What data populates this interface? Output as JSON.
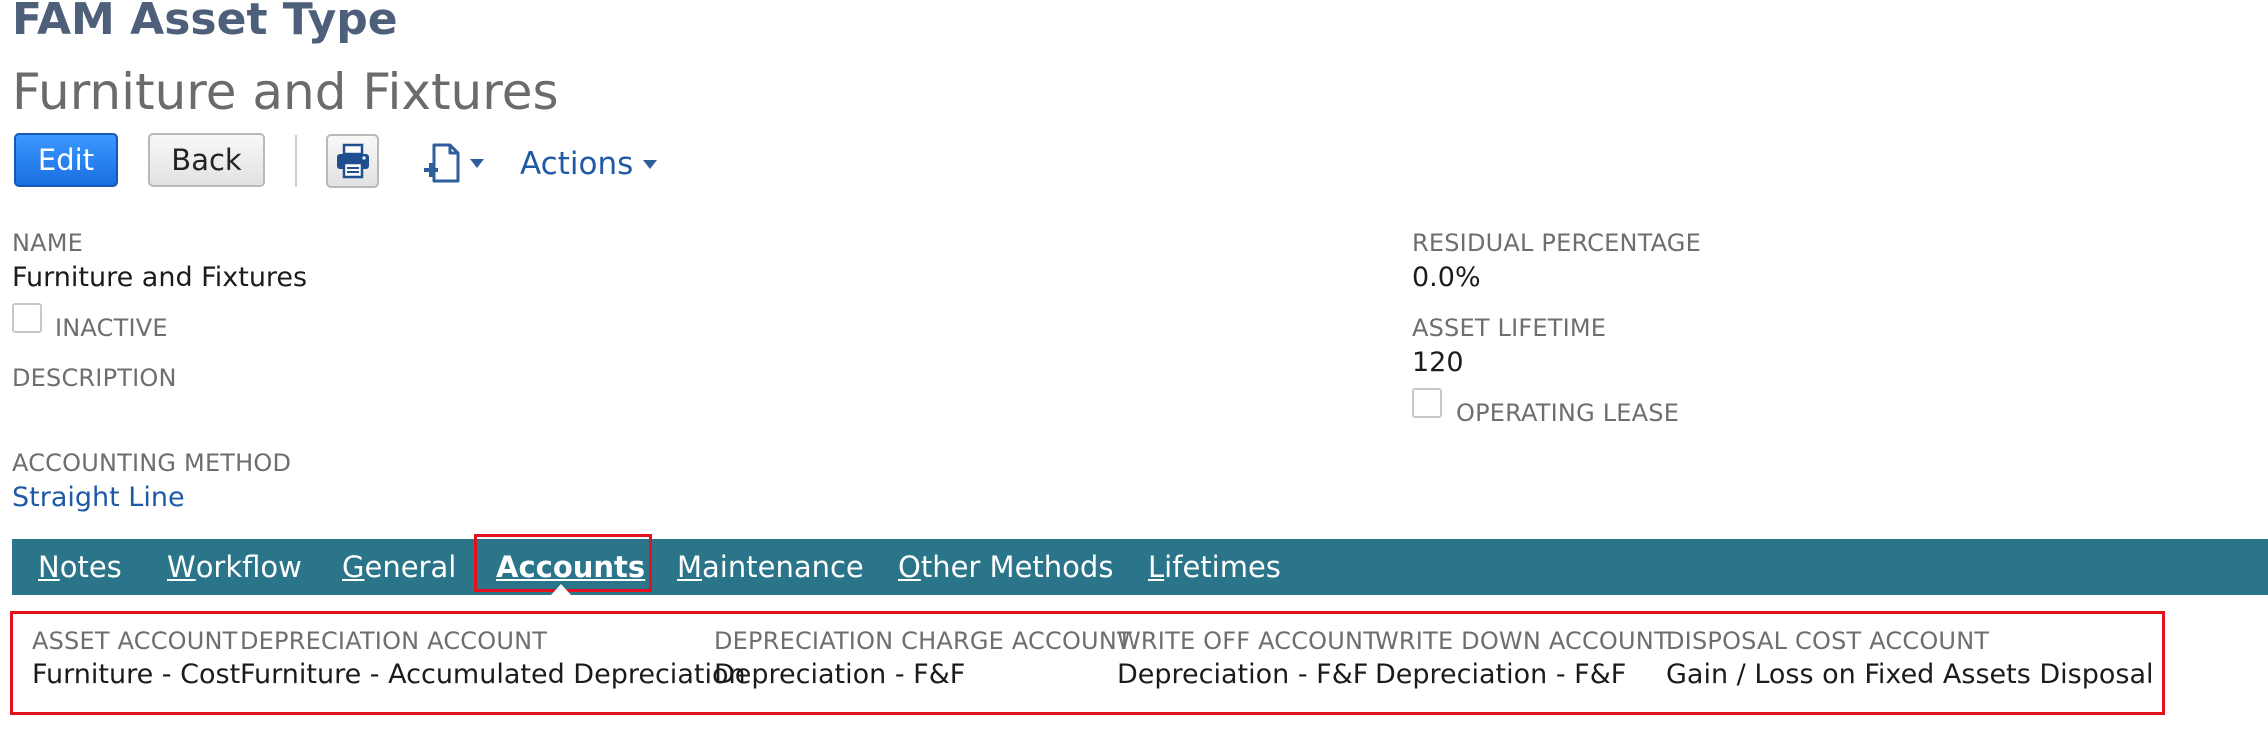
{
  "header": {
    "record_type": "FAM Asset Type",
    "record_name": "Furniture and Fixtures"
  },
  "toolbar": {
    "edit_label": "Edit",
    "back_label": "Back",
    "actions_label": "Actions"
  },
  "fields": {
    "name_label": "NAME",
    "name_value": "Furniture and Fixtures",
    "inactive_label": "INACTIVE",
    "inactive_checked": false,
    "description_label": "DESCRIPTION",
    "accounting_method_label": "ACCOUNTING METHOD",
    "accounting_method_value": "Straight Line",
    "residual_percentage_label": "RESIDUAL PERCENTAGE",
    "residual_percentage_value": "0.0%",
    "asset_lifetime_label": "ASSET LIFETIME",
    "asset_lifetime_value": "120",
    "operating_lease_label": "OPERATING LEASE",
    "operating_lease_checked": false
  },
  "tabs": [
    {
      "key": "N",
      "rest": "otes",
      "active": false
    },
    {
      "key": "W",
      "rest": "orkflow",
      "active": false
    },
    {
      "key": "G",
      "rest": "eneral",
      "active": false
    },
    {
      "key": "A",
      "rest": "ccounts",
      "active": true
    },
    {
      "key": "M",
      "rest": "aintenance",
      "active": false
    },
    {
      "key": "O",
      "rest": "ther Methods",
      "active": false
    },
    {
      "key": "L",
      "rest": "ifetimes",
      "active": false
    }
  ],
  "accounts": {
    "asset_account_label": "ASSET ACCOUNT",
    "asset_account_value": "Furniture - Cost",
    "depreciation_account_label": "DEPRECIATION ACCOUNT",
    "depreciation_account_value": "Furniture - Accumulated Depreciation",
    "depreciation_charge_account_label": "DEPRECIATION CHARGE ACCOUNT",
    "depreciation_charge_account_value": "Depreciation - F&F",
    "write_off_account_label": "WRITE OFF ACCOUNT",
    "write_off_account_value": "Depreciation - F&F",
    "write_down_account_label": "WRITE DOWN ACCOUNT",
    "write_down_account_value": "Depreciation - F&F",
    "disposal_cost_account_label": "DISPOSAL COST ACCOUNT",
    "disposal_cost_account_value": "Gain / Loss on Fixed Assets Disposal"
  },
  "colors": {
    "title": "#4d5f79",
    "link": "#1f5aa6",
    "tabbar": "#2a7589",
    "highlight": "#e3101e",
    "primary_button": "#1a6fe0"
  },
  "icons": {
    "print": "printer-icon",
    "new_document": "new-document-icon",
    "dropdown": "chevron-down-icon"
  }
}
